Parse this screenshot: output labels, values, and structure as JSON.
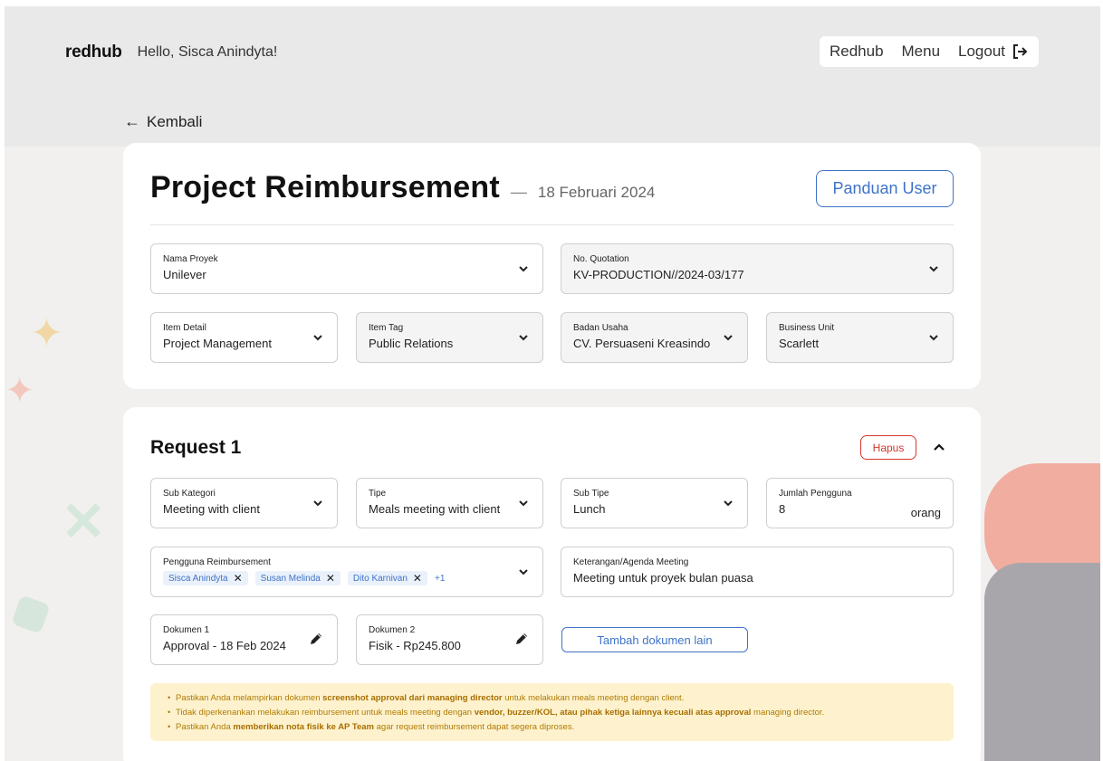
{
  "header": {
    "logo": "redhub",
    "greeting": "Hello, Sisca Anindyta!",
    "nav": {
      "redhub": "Redhub",
      "menu": "Menu",
      "logout": "Logout"
    }
  },
  "back_label": "Kembali",
  "project": {
    "title": "Project Reimbursement",
    "dash": "—",
    "date": "18 Februari 2024",
    "guide_button": "Panduan User",
    "fields": {
      "nama_proyek": {
        "label": "Nama Proyek",
        "value": "Unilever"
      },
      "no_quotation": {
        "label": "No. Quotation",
        "value": "KV-PRODUCTION//2024-03/177"
      },
      "item_detail": {
        "label": "Item Detail",
        "value": "Project Management"
      },
      "item_tag": {
        "label": "Item Tag",
        "value": "Public Relations"
      },
      "badan_usaha": {
        "label": "Badan Usaha",
        "value": "CV. Persuaseni Kreasindo"
      },
      "business_unit": {
        "label": "Business Unit",
        "value": "Scarlett"
      }
    }
  },
  "request": {
    "title": "Request 1",
    "delete_button": "Hapus",
    "fields": {
      "sub_kategori": {
        "label": "Sub Kategori",
        "value": "Meeting with client"
      },
      "tipe": {
        "label": "Tipe",
        "value": "Meals meeting with client"
      },
      "sub_tipe": {
        "label": "Sub Tipe",
        "value": "Lunch"
      },
      "jumlah_pengguna": {
        "label": "Jumlah Pengguna",
        "value": "8",
        "unit": "orang"
      },
      "pengguna": {
        "label": "Pengguna Reimbursement",
        "chips": [
          "Sisca Anindyta",
          "Susan Melinda",
          "Dito Karnivan"
        ],
        "more": "+1"
      },
      "keterangan": {
        "label": "Keterangan/Agenda Meeting",
        "value": "Meeting untuk proyek bulan puasa"
      },
      "dokumen1": {
        "label": "Dokumen 1",
        "value": "Approval - 18 Feb 2024"
      },
      "dokumen2": {
        "label": "Dokumen 2",
        "value": "Fisik - Rp245.800"
      }
    },
    "add_doc_button": "Tambah dokumen lain",
    "notices": [
      {
        "pre": "Pastikan Anda melampirkan dokumen ",
        "bold": "screenshot approval dari managing director",
        "post": " untuk melakukan meals meeting dengan client."
      },
      {
        "pre": "Tidak diperkenankan melakukan reimbursement untuk meals meeting dengan ",
        "bold": "vendor, buzzer/KOL, atau pihak ketiga lainnya kecuali atas approval",
        "post": " managing director."
      },
      {
        "pre": "Pastikan Anda ",
        "bold": "memberikan nota fisik ke AP Team",
        "post": " agar request reimbursement dapat segera diproses."
      }
    ]
  },
  "colors": {
    "accent_blue": "#3e73c8",
    "danger_red": "#d2372f",
    "notice_bg": "#fdf2cd",
    "notice_text": "#b07a05"
  },
  "icons": [
    "back-arrow-icon",
    "logout-icon",
    "chevron-down-icon",
    "chevron-up-icon",
    "pencil-icon",
    "close-icon"
  ]
}
